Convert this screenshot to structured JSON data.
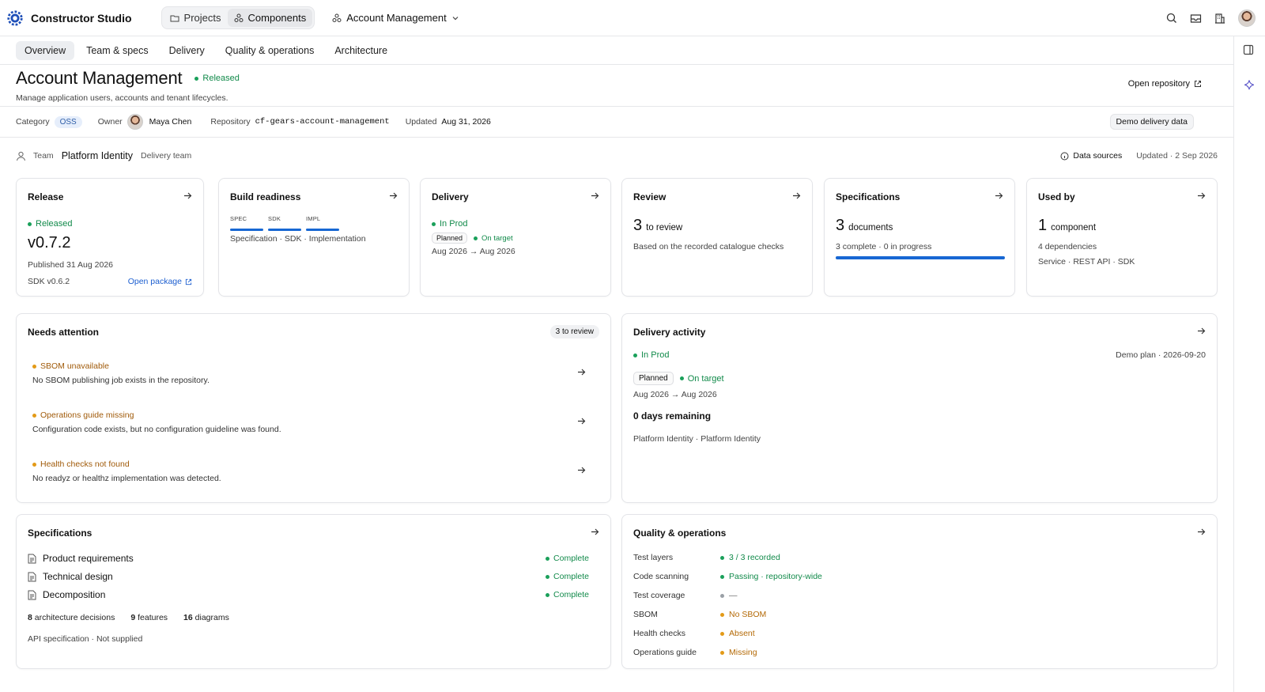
{
  "app": {
    "name": "Constructor Studio"
  },
  "nav": {
    "segments": [
      {
        "label": "Projects"
      },
      {
        "label": "Components"
      }
    ],
    "project_switcher": "Account Management"
  },
  "tabs": [
    {
      "label": "Overview"
    },
    {
      "label": "Team & specs"
    },
    {
      "label": "Delivery"
    },
    {
      "label": "Quality & operations"
    },
    {
      "label": "Architecture"
    }
  ],
  "header": {
    "title": "Account Management",
    "status": "Released",
    "description": "Manage application users, accounts and tenant lifecycles.",
    "open_repository": "Open repository"
  },
  "meta": {
    "category_label": "Category",
    "category_value": "OSS",
    "owner_label": "Owner",
    "owner_value": "Maya Chen",
    "repository_label": "Repository",
    "repository_value": "cf-gears-account-management",
    "updated_label": "Updated",
    "updated_value": "Aug 31, 2026",
    "demo_badge": "Demo delivery data"
  },
  "team": {
    "label": "Team",
    "name": "Platform Identity",
    "sub": "Delivery team",
    "data_sources": "Data sources",
    "updated": "Updated · 2 Sep 2026"
  },
  "cards": {
    "release": {
      "title": "Release",
      "status": "Released",
      "version": "v0.7.2",
      "published": "Published 31 Aug 2026",
      "sdk": "SDK v0.6.2",
      "open_package": "Open package"
    },
    "build": {
      "title": "Build readiness",
      "labels": [
        "SPEC",
        "SDK",
        "IMPL"
      ],
      "desc": "Specification · SDK · Implementation"
    },
    "delivery": {
      "title": "Delivery",
      "status": "In Prod",
      "planned": "Planned",
      "target": "On target",
      "range": "Aug 2026 → Aug 2026"
    },
    "review": {
      "title": "Review",
      "count": "3",
      "count_label": "to review",
      "desc": "Based on the recorded catalogue checks"
    },
    "specs": {
      "title": "Specifications",
      "count": "3",
      "count_label": "documents",
      "desc": "3 complete · 0 in progress",
      "progress": 1.0
    },
    "usedby": {
      "title": "Used by",
      "count": "1",
      "count_label": "component",
      "deps": "4 dependencies",
      "types": "Service · REST API · SDK"
    }
  },
  "attention": {
    "title": "Needs attention",
    "badge": "3 to review",
    "items": [
      {
        "title": "SBOM unavailable",
        "desc": "No SBOM publishing job exists in the repository."
      },
      {
        "title": "Operations guide missing",
        "desc": "Configuration code exists, but no configuration guideline was found."
      },
      {
        "title": "Health checks not found",
        "desc": "No readyz or healthz implementation was detected."
      }
    ]
  },
  "activity": {
    "title": "Delivery activity",
    "status": "In Prod",
    "plan": "Demo plan · 2026-09-20",
    "planned": "Planned",
    "target": "On target",
    "range": "Aug 2026 → Aug 2026",
    "remaining": "0 days remaining",
    "teams": "Platform Identity · Platform Identity"
  },
  "specifications": {
    "title": "Specifications",
    "docs": [
      {
        "name": "Product requirements",
        "status": "Complete"
      },
      {
        "name": "Technical design",
        "status": "Complete"
      },
      {
        "name": "Decomposition",
        "status": "Complete"
      }
    ],
    "stats": [
      {
        "n": "8",
        "label": "architecture decisions"
      },
      {
        "n": "9",
        "label": "features"
      },
      {
        "n": "16",
        "label": "diagrams"
      }
    ],
    "api": "API specification · Not supplied"
  },
  "quality": {
    "title": "Quality & operations",
    "rows": [
      {
        "key": "Test layers",
        "value": "3 / 3 recorded",
        "tone": "green"
      },
      {
        "key": "Code scanning",
        "value": "Passing · repository-wide",
        "tone": "green"
      },
      {
        "key": "Test coverage",
        "value": "—",
        "tone": "grey"
      },
      {
        "key": "SBOM",
        "value": "No SBOM",
        "tone": "orange"
      },
      {
        "key": "Health checks",
        "value": "Absent",
        "tone": "orange"
      },
      {
        "key": "Operations guide",
        "value": "Missing",
        "tone": "orange"
      }
    ]
  },
  "colors": {
    "accent": "#1767d3",
    "green": "#1aa05a",
    "orange": "#e39a18"
  }
}
